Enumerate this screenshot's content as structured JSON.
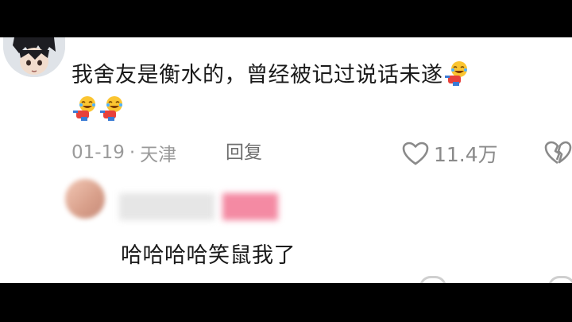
{
  "comment": {
    "username": "",
    "text": "我舍友是衡水的，曾经被记过说话未遂",
    "emoji_icon": "laughing-crying-emoji",
    "date": "01-19",
    "separator": "·",
    "location": "天津",
    "reply_label": "回复",
    "like_count": "11.4万"
  },
  "reply": {
    "text": "哈哈哈哈笑鼠我了"
  },
  "colors": {
    "text": "#1a1a1a",
    "meta": "#9a9a9a",
    "background": "#ffffff"
  }
}
